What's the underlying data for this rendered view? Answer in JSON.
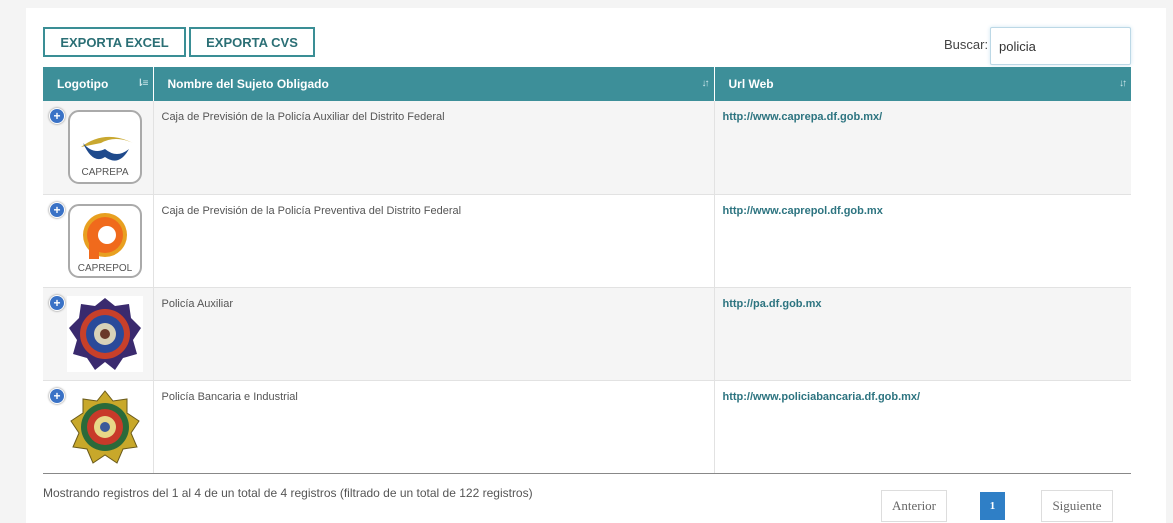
{
  "toolbar": {
    "export_excel_label": "EXPORTA EXCEL",
    "export_cvs_label": "EXPORTA CVS"
  },
  "search": {
    "label": "Buscar:",
    "value": "policia"
  },
  "table": {
    "columns": [
      {
        "label": "Logotipo",
        "sort": "sorted-asc"
      },
      {
        "label": "Nombre del Sujeto Obligado",
        "sort": "sortable"
      },
      {
        "label": "Url Web",
        "sort": "sortable"
      }
    ],
    "rows": [
      {
        "logo": "caprepa-logo",
        "logo_text": "CAPREPA",
        "name": "Caja de Previsión de la Policía Auxiliar del Distrito Federal",
        "url": "http://www.caprepa.df.gob.mx/"
      },
      {
        "logo": "caprepol-logo",
        "logo_text": "CAPREPOL",
        "name": "Caja de Previsión de la Policía Preventiva del Distrito Federal",
        "url": "http://www.caprepol.df.gob.mx"
      },
      {
        "logo": "policia-auxiliar-badge",
        "name": "Policía Auxiliar",
        "url": "http://pa.df.gob.mx"
      },
      {
        "logo": "policia-bancaria-badge",
        "name": "Policía Bancaria e Industrial",
        "url": "http://www.policiabancaria.df.gob.mx/"
      }
    ]
  },
  "footer": {
    "info": "Mostrando registros del 1 al 4 de un total de 4 registros (filtrado de un total de 122 registros)"
  },
  "pagination": {
    "prev_label": "Anterior",
    "current_page": "1",
    "next_label": "Siguiente"
  },
  "colors": {
    "header_bg": "#3d8f99",
    "button_border": "#3a8e95",
    "link": "#2d7480",
    "active_page": "#2f7fc6"
  }
}
